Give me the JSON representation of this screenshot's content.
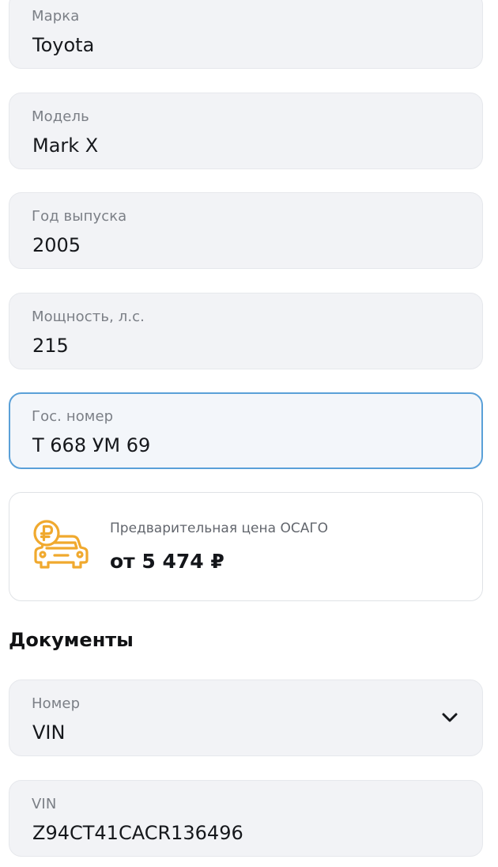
{
  "fields": {
    "brand": {
      "label": "Марка",
      "value": "Toyota"
    },
    "model": {
      "label": "Модель",
      "value": "Mark X"
    },
    "year": {
      "label": "Год выпуска",
      "value": "2005"
    },
    "power": {
      "label": "Мощность, л.с.",
      "value": "215"
    },
    "plate": {
      "label": "Гос. номер",
      "value": "Т 668 УМ 69"
    }
  },
  "price_card": {
    "label": "Предварительная цена ОСАГО",
    "value": "от 5 474 ₽",
    "icon": "car-ruble-icon",
    "icon_color": "#f0a92e"
  },
  "documents": {
    "title": "Документы",
    "number_type": {
      "label": "Номер",
      "value": "VIN"
    },
    "vin": {
      "label": "VIN",
      "value": "Z94CT41CACR136496"
    }
  },
  "colors": {
    "focus_border": "#5aa0d8",
    "field_background": "#f2f3f6"
  }
}
